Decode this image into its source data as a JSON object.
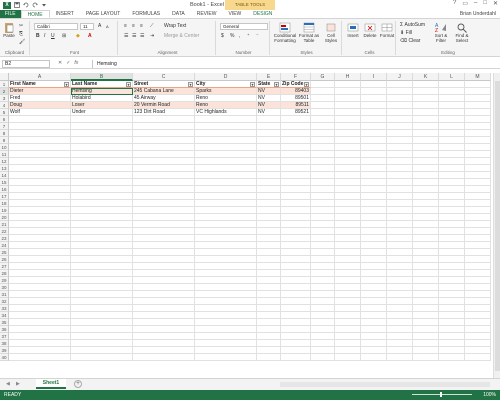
{
  "app": {
    "title": "Book1 - Excel",
    "contextual_tab_group": "TABLE TOOLS",
    "user": "Brian Underdahl"
  },
  "ribbon_tabs": [
    "FILE",
    "HOME",
    "INSERT",
    "PAGE LAYOUT",
    "FORMULAS",
    "DATA",
    "REVIEW",
    "VIEW",
    "DESIGN"
  ],
  "ribbon": {
    "clipboard": {
      "label": "Clipboard",
      "paste": "Paste"
    },
    "font": {
      "label": "Font",
      "name": "Calibri",
      "size": "11"
    },
    "alignment": {
      "label": "Alignment",
      "wrap": "Wrap Text",
      "merge": "Merge & Center"
    },
    "number": {
      "label": "Number",
      "format": "General"
    },
    "styles": {
      "label": "Styles",
      "conditional": "Conditional Formatting",
      "format_table": "Format as Table",
      "cell_styles": "Cell Styles"
    },
    "cells": {
      "label": "Cells",
      "insert": "Insert",
      "delete": "Delete",
      "format": "Format"
    },
    "editing": {
      "label": "Editing",
      "autosum": "AutoSum",
      "fill": "Fill",
      "clear": "Clear",
      "sort": "Sort & Filter",
      "find": "Find & Select"
    }
  },
  "formula_bar": {
    "name_box": "B2",
    "fx": "fx",
    "value": "Hemsing"
  },
  "columns": [
    "A",
    "B",
    "C",
    "D",
    "E",
    "F",
    "G",
    "H",
    "I",
    "J",
    "K",
    "L",
    "M"
  ],
  "rows": [
    "1",
    "2",
    "3",
    "4",
    "5",
    "6",
    "7",
    "8",
    "9",
    "10",
    "11",
    "12",
    "13",
    "14",
    "15",
    "16",
    "17",
    "18",
    "19",
    "20",
    "21",
    "22",
    "23",
    "24",
    "25",
    "26",
    "27",
    "28",
    "29",
    "30",
    "31",
    "32",
    "33",
    "34",
    "35",
    "36",
    "37",
    "38",
    "39",
    "40"
  ],
  "table": {
    "headers": [
      "First Name",
      "Last Name",
      "Street",
      "City",
      "State",
      "Zip Code"
    ],
    "rows": [
      [
        "Dieter",
        "Hemsing",
        "245 Cabana Lane",
        "Sparks",
        "NV",
        "89403"
      ],
      [
        "Fred",
        "Holabird",
        "45 Airway",
        "Reno",
        "NV",
        "89501"
      ],
      [
        "Doug",
        "Loser",
        "20 Vermin Road",
        "Reno",
        "NV",
        "89511"
      ],
      [
        "Wolf",
        "Under",
        "123 Dirt Road",
        "VC Highlands",
        "NV",
        "89521"
      ]
    ]
  },
  "sheet_tabs": [
    "Sheet1"
  ],
  "status": {
    "mode": "READY",
    "zoom": "100%"
  },
  "colors": {
    "accent": "#217346",
    "table_band": "#fbe3d9",
    "table_header_border": "#e9a48a",
    "contextual_tab": "#f7d88e"
  }
}
